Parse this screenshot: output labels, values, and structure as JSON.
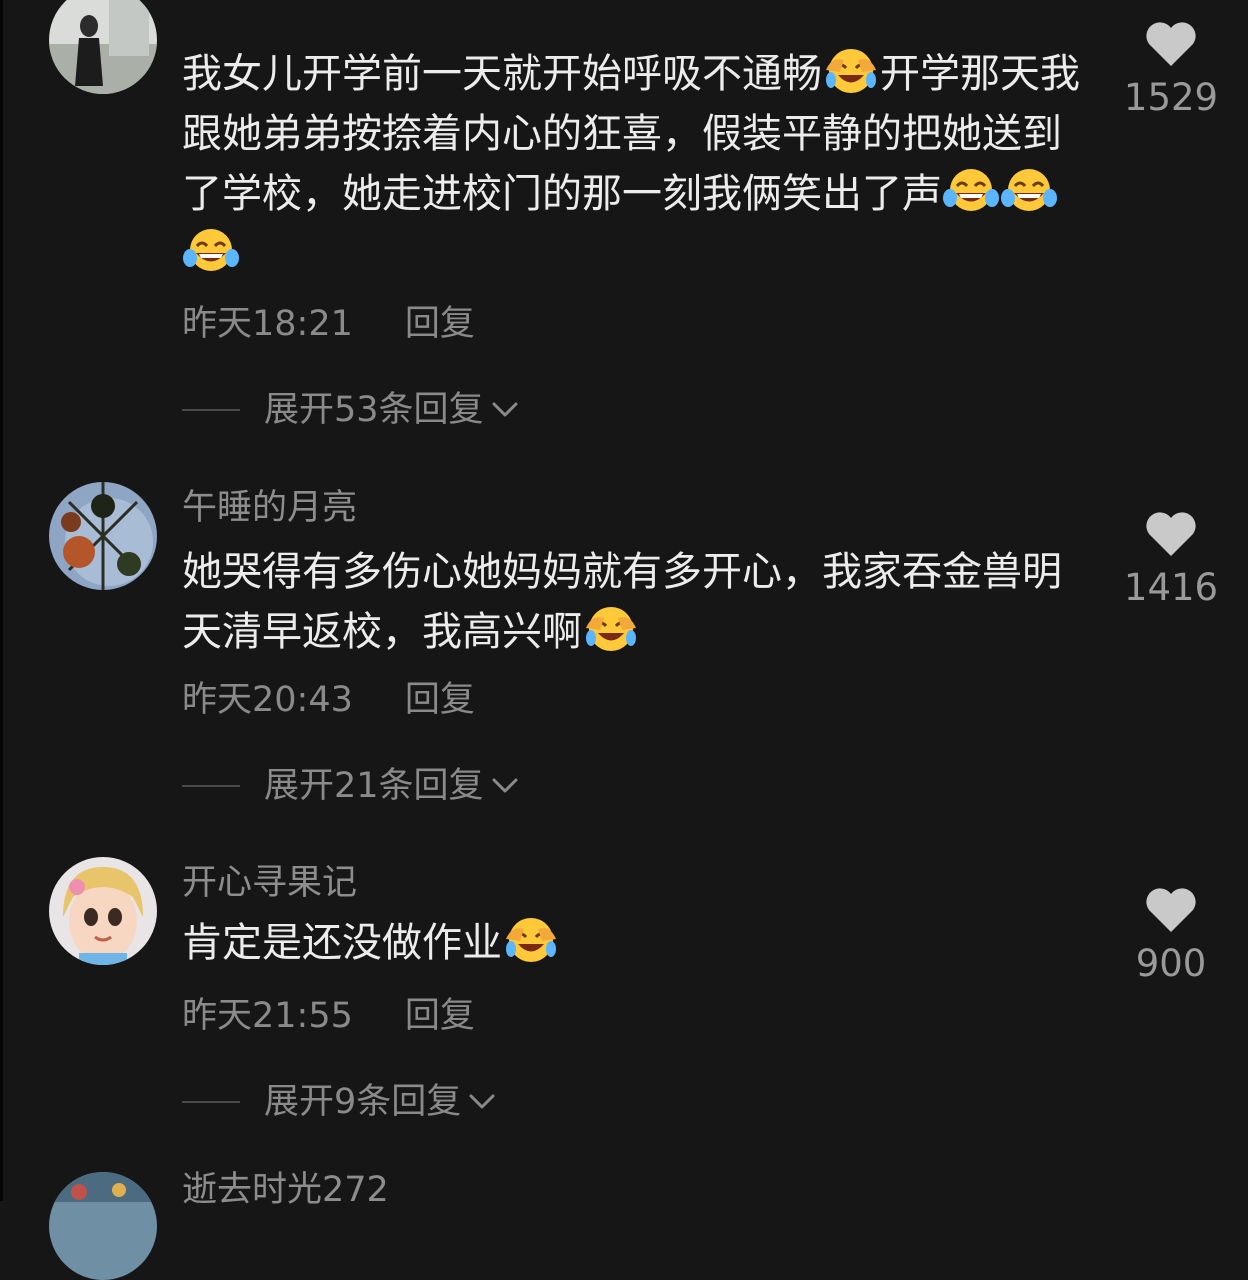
{
  "comments": [
    {
      "username": "",
      "text": [
        "我女儿开学前一天就开始呼吸不通畅",
        "开学那天我跟她弟弟按捺着内心的狂喜，假装平静的把她送到了学校，她走进校门的那一刻我俩笑出了声"
      ],
      "time": "昨天18:21",
      "reply_label": "回复",
      "expand_label": "展开53条回复",
      "likes": "1529"
    },
    {
      "username": "午睡的月亮",
      "text": [
        "她哭得有多伤心她妈妈就有多开心，我家吞金兽明天清早返校，我高兴啊"
      ],
      "time": "昨天20:43",
      "reply_label": "回复",
      "expand_label": "展开21条回复",
      "likes": "1416"
    },
    {
      "username": "开心寻果记",
      "text": [
        "肯定是还没做作业"
      ],
      "time": "昨天21:55",
      "reply_label": "回复",
      "expand_label": "展开9条回复",
      "likes": "900"
    },
    {
      "username": "逝去时光272"
    }
  ],
  "icons": {
    "like": "heart-icon",
    "expand": "chevron-down-icon",
    "emoji_covering_face": "laughing-covering-face-emoji",
    "emoji_tears_of_joy": "tears-of-joy-emoji"
  },
  "colors": {
    "background": "#161616",
    "text": "#ececec",
    "muted": "#8a8a8a",
    "heart": "#c9c9c9",
    "emoji_yellow": "#ffc93a"
  }
}
